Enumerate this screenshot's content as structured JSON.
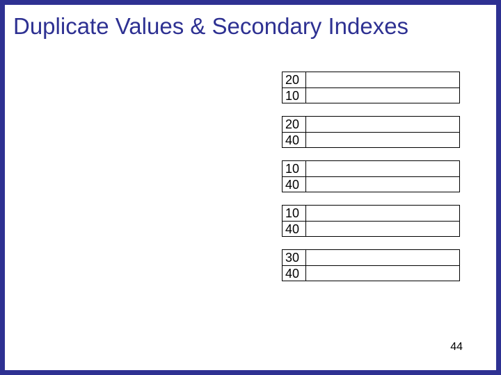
{
  "title": "Duplicate Values & Secondary Indexes",
  "page_number": "44",
  "blocks": [
    {
      "rows": [
        "20",
        "10"
      ]
    },
    {
      "rows": [
        "20",
        "40"
      ]
    },
    {
      "rows": [
        "10",
        "40"
      ]
    },
    {
      "rows": [
        "10",
        "40"
      ]
    },
    {
      "rows": [
        "30",
        "40"
      ]
    }
  ]
}
